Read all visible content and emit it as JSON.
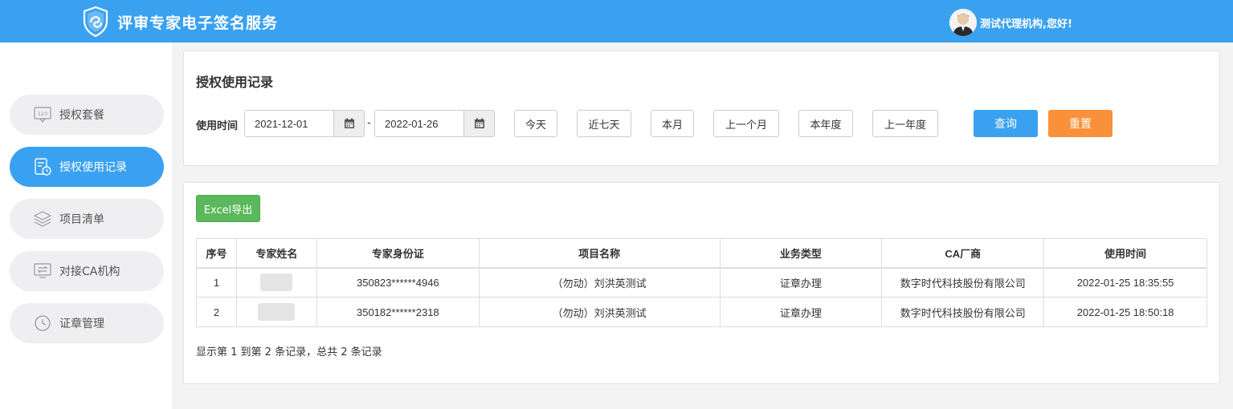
{
  "app": {
    "title": "评审专家电子签名服务",
    "greeting": "测试代理机构,您好!"
  },
  "sidebar": {
    "items": [
      {
        "label": "授权套餐",
        "icon": "package-123-icon",
        "active": false
      },
      {
        "label": "授权使用记录",
        "icon": "record-clock-icon",
        "active": true
      },
      {
        "label": "项目清单",
        "icon": "layers-icon",
        "active": false
      },
      {
        "label": "对接CA机构",
        "icon": "exchange-icon",
        "active": false
      },
      {
        "label": "证章管理",
        "icon": "clock-icon",
        "active": false
      }
    ]
  },
  "filter": {
    "title": "授权使用记录",
    "label": "使用时间",
    "start_date": "2021-12-01",
    "end_date": "2022-01-26",
    "separator": "-",
    "quick": [
      "今天",
      "近七天",
      "本月",
      "上一个月",
      "本年度",
      "上一年度"
    ],
    "search_label": "查询",
    "reset_label": "重置"
  },
  "records": {
    "export_label": "Excel导出",
    "headers": [
      "序号",
      "专家姓名",
      "专家身份证",
      "项目名称",
      "业务类型",
      "CA厂商",
      "使用时间"
    ],
    "rows": [
      {
        "no": "1",
        "id": "350823******4946",
        "project": "（勿动）刘洪英测试",
        "type": "证章办理",
        "ca": "数字时代科技股份有限公司",
        "time": "2022-01-25 18:35:55"
      },
      {
        "no": "2",
        "id": "350182******2318",
        "project": "（勿动）刘洪英测试",
        "type": "证章办理",
        "ca": "数字时代科技股份有限公司",
        "time": "2022-01-25 18:50:18"
      }
    ],
    "summary": "显示第 1 到第 2 条记录，总共 2 条记录"
  }
}
